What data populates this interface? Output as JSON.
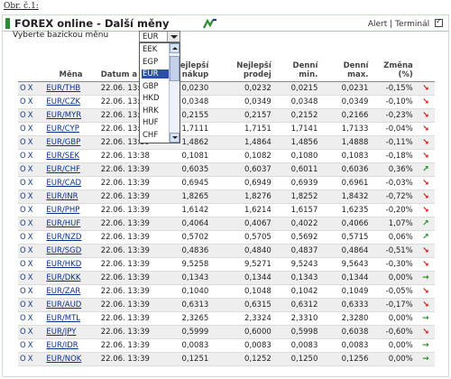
{
  "page_label": "Obr. č.1:",
  "header": {
    "title": "FOREX online - Další měny",
    "alert": "Alert",
    "separator": "|",
    "terminal": "Terminál"
  },
  "base_select": {
    "label": "Vyberte bazickou měnu",
    "value": "EUR",
    "options": [
      "EEK",
      "EGP",
      "EUR",
      "GBP",
      "HKD",
      "HRK",
      "HUF",
      "CHF"
    ],
    "selected_index": 2
  },
  "colors": {
    "accent": "#2e8b32",
    "link": "#0b2f8a",
    "down": "#d01010",
    "up": "#1a8a24",
    "selection": "#2a4fa8"
  },
  "table": {
    "columns": {
      "mena": "Měna",
      "datum": "Datum a čas",
      "nakup": "Nejlepší nákup",
      "prodej": "Nejlepší prodej",
      "min": "Denní min.",
      "max": "Denní max.",
      "zmena": "Změna (%)"
    },
    "rows": [
      {
        "o": "O",
        "x": "X",
        "pair": "EUR/THB",
        "time": "22.06. 13:39",
        "buy": "0,0230",
        "sell": "0,0232",
        "min": "0,0215",
        "max": "0,0231",
        "chg": "-0,15%",
        "dir": "down"
      },
      {
        "o": "O",
        "x": "X",
        "pair": "EUR/CZK",
        "time": "22.06. 13:43",
        "buy": "0,0348",
        "sell": "0,0349",
        "min": "0,0348",
        "max": "0,0349",
        "chg": "-0,10%",
        "dir": "down"
      },
      {
        "o": "O",
        "x": "X",
        "pair": "EUR/MYR",
        "time": "22.06. 13:39",
        "buy": "0,2155",
        "sell": "0,2157",
        "min": "0,2152",
        "max": "0,2166",
        "chg": "-0,23%",
        "dir": "down"
      },
      {
        "o": "O",
        "x": "X",
        "pair": "EUR/CYP",
        "time": "22.06. 13:39",
        "buy": "1,7111",
        "sell": "1,7151",
        "min": "1,7141",
        "max": "1,7133",
        "chg": "-0,04%",
        "dir": "down"
      },
      {
        "o": "O",
        "x": "X",
        "pair": "EUR/GBP",
        "time": "22.06. 13:39",
        "buy": "1,4862",
        "sell": "1,4864",
        "min": "1,4856",
        "max": "1,4888",
        "chg": "-0,11%",
        "dir": "down"
      },
      {
        "o": "O",
        "x": "X",
        "pair": "EUR/SEK",
        "time": "22.06. 13:38",
        "buy": "0,1081",
        "sell": "0,1082",
        "min": "0,1080",
        "max": "0,1083",
        "chg": "-0,18%",
        "dir": "down"
      },
      {
        "o": "O",
        "x": "X",
        "pair": "EUR/CHF",
        "time": "22.06. 13:39",
        "buy": "0,6035",
        "sell": "0,6037",
        "min": "0,6011",
        "max": "0,6036",
        "chg": "0,36%",
        "dir": "up"
      },
      {
        "o": "O",
        "x": "X",
        "pair": "EUR/CAD",
        "time": "22.06. 13:39",
        "buy": "0,6945",
        "sell": "0,6949",
        "min": "0,6939",
        "max": "0,6961",
        "chg": "-0,03%",
        "dir": "down"
      },
      {
        "o": "O",
        "x": "X",
        "pair": "EUR/INR",
        "time": "22.06. 13:39",
        "buy": "1,8265",
        "sell": "1,8276",
        "min": "1,8252",
        "max": "1,8432",
        "chg": "-0,72%",
        "dir": "down"
      },
      {
        "o": "O",
        "x": "X",
        "pair": "EUR/PHP",
        "time": "22.06. 13:39",
        "buy": "1,6142",
        "sell": "1,6214",
        "min": "1,6157",
        "max": "1,6235",
        "chg": "-0,20%",
        "dir": "down"
      },
      {
        "o": "O",
        "x": "X",
        "pair": "EUR/HUF",
        "time": "22.06. 13:39",
        "buy": "0,4064",
        "sell": "0,4067",
        "min": "0,4022",
        "max": "0,4066",
        "chg": "1,07%",
        "dir": "up"
      },
      {
        "o": "O",
        "x": "X",
        "pair": "EUR/NZD",
        "time": "22.06. 13:39",
        "buy": "0,5702",
        "sell": "0,5705",
        "min": "0,5692",
        "max": "0,5715",
        "chg": "0,06%",
        "dir": "up"
      },
      {
        "o": "O",
        "x": "X",
        "pair": "EUR/SGD",
        "time": "22.06. 13:39",
        "buy": "0,4836",
        "sell": "0,4840",
        "min": "0,4837",
        "max": "0,4864",
        "chg": "-0,51%",
        "dir": "down"
      },
      {
        "o": "O",
        "x": "X",
        "pair": "EUR/HKD",
        "time": "22.06. 13:39",
        "buy": "9,5258",
        "sell": "9,5271",
        "min": "9,5243",
        "max": "9,5643",
        "chg": "-0,30%",
        "dir": "down"
      },
      {
        "o": "O",
        "x": "X",
        "pair": "EUR/DKK",
        "time": "22.06. 13:39",
        "buy": "0,1343",
        "sell": "0,1344",
        "min": "0,1343",
        "max": "0,1344",
        "chg": "0,00%",
        "dir": "flat"
      },
      {
        "o": "O",
        "x": "X",
        "pair": "EUR/ZAR",
        "time": "22.06. 13:39",
        "buy": "0,1040",
        "sell": "0,1048",
        "min": "0,1042",
        "max": "0,1049",
        "chg": "-0,05%",
        "dir": "down"
      },
      {
        "o": "O",
        "x": "X",
        "pair": "EUR/AUD",
        "time": "22.06. 13:39",
        "buy": "0,6313",
        "sell": "0,6315",
        "min": "0,6312",
        "max": "0,6333",
        "chg": "-0,17%",
        "dir": "down"
      },
      {
        "o": "O",
        "x": "X",
        "pair": "EUR/MTL",
        "time": "22.06. 13:39",
        "buy": "2,3265",
        "sell": "2,3324",
        "min": "2,3310",
        "max": "2,3280",
        "chg": "0,00%",
        "dir": "flat"
      },
      {
        "o": "O",
        "x": "X",
        "pair": "EUR/JPY",
        "time": "22.06. 13:39",
        "buy": "0,5999",
        "sell": "0,6000",
        "min": "0,5998",
        "max": "0,6038",
        "chg": "-0,60%",
        "dir": "down"
      },
      {
        "o": "O",
        "x": "X",
        "pair": "EUR/IDR",
        "time": "22.06. 13:39",
        "buy": "0,0083",
        "sell": "0,0083",
        "min": "0,0083",
        "max": "0,0083",
        "chg": "0,00%",
        "dir": "flat"
      },
      {
        "o": "O",
        "x": "X",
        "pair": "EUR/NOK",
        "time": "22.06. 13:39",
        "buy": "0,1251",
        "sell": "0,1252",
        "min": "0,1250",
        "max": "0,1256",
        "chg": "0,00%",
        "dir": "flat"
      }
    ]
  },
  "icons": {
    "down": "down-right-arrow-icon",
    "up": "up-right-arrow-icon",
    "flat": "right-arrow-icon",
    "logo": "chart-logo-icon",
    "checkbox": "checkbox-icon"
  }
}
